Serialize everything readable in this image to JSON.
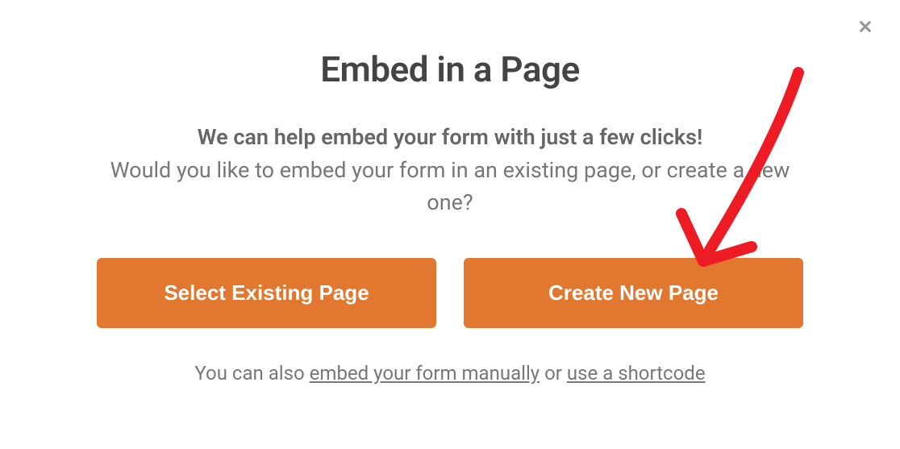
{
  "modal": {
    "title": "Embed in a Page",
    "desc_bold": "We can help embed your form with just a few clicks!",
    "desc_rest": "Would you like to embed your form in an existing page, or create a new one?",
    "buttons": {
      "select_existing": "Select Existing Page",
      "create_new": "Create New Page"
    },
    "footer": {
      "prefix": "You can also ",
      "link1": "embed your form manually",
      "middle": " or ",
      "link2": "use a shortcode"
    }
  }
}
